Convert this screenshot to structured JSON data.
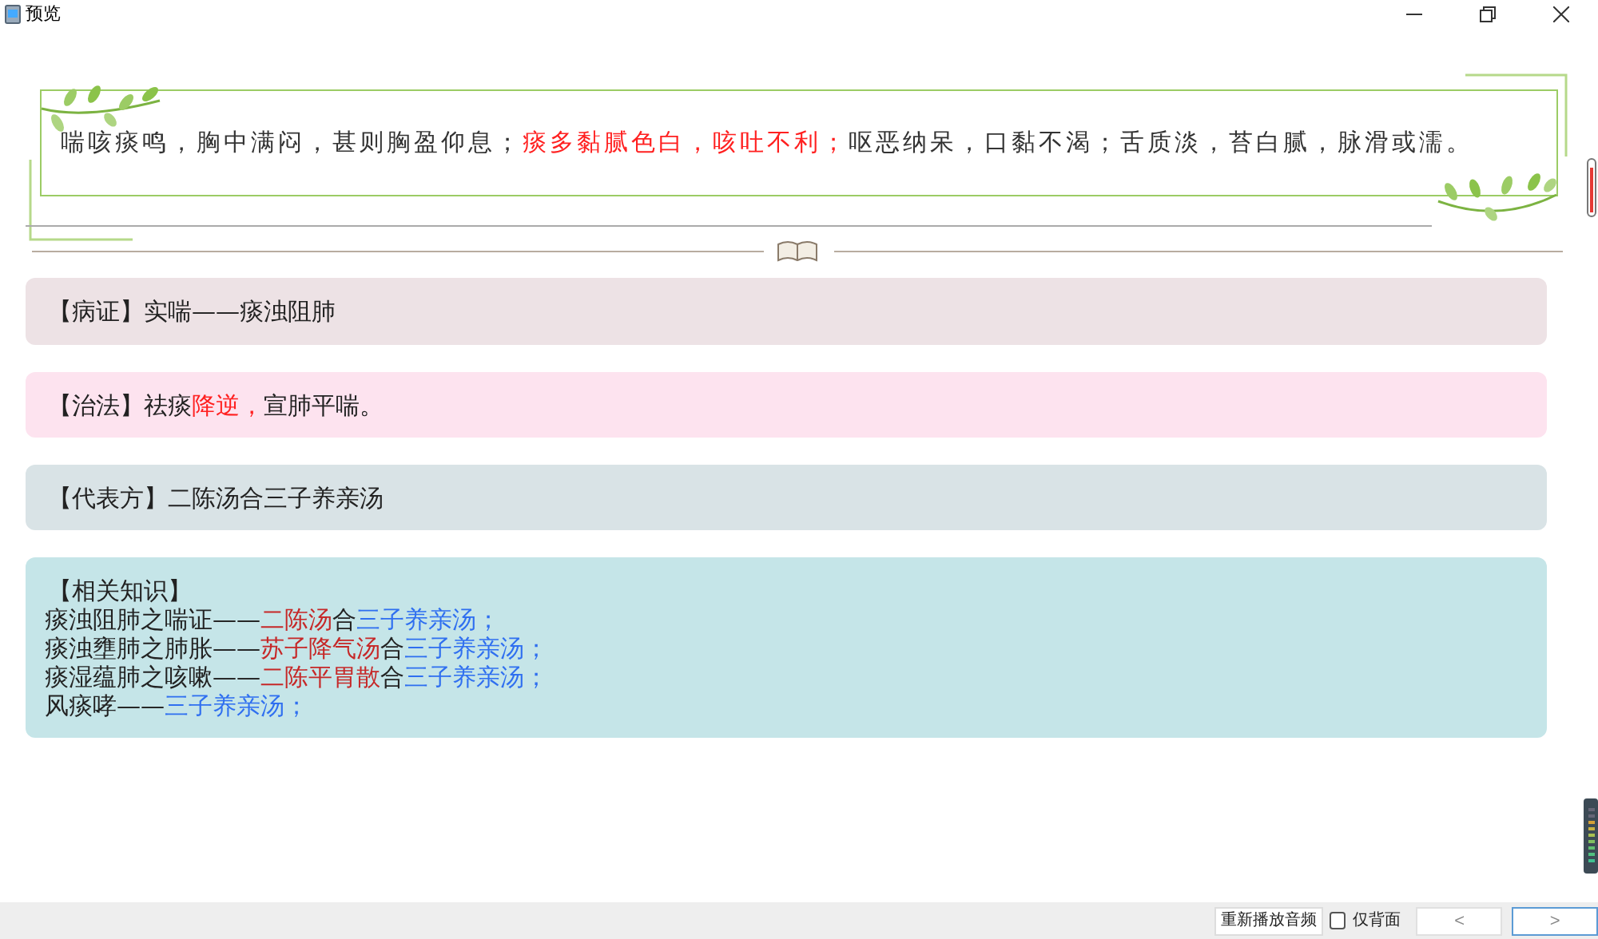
{
  "window": {
    "title": "预览"
  },
  "symptoms": [
    {
      "text": "喘咳痰鸣，胸中满闷，甚则胸盈仰息；",
      "kind": "normal"
    },
    {
      "text": "痰多黏腻色白，咳吐不利；",
      "kind": "key"
    },
    {
      "text": "呕恶纳呆，口黏不渴；舌质淡，苔白腻，脉滑或濡。",
      "kind": "normal"
    }
  ],
  "cards": [
    {
      "kind": "syndrome",
      "lines": [
        [
          {
            "text": "【病证】实喘——痰浊阻肺",
            "kind": "normal"
          }
        ]
      ]
    },
    {
      "kind": "method",
      "lines": [
        [
          {
            "text": "【治法】祛痰",
            "kind": "normal"
          },
          {
            "text": "降逆，",
            "kind": "key"
          },
          {
            "text": "宣肺平喘。",
            "kind": "normal"
          }
        ]
      ]
    },
    {
      "kind": "formula",
      "lines": [
        [
          {
            "text": "【代表方】二陈汤合三子养亲汤",
            "kind": "normal"
          }
        ]
      ]
    },
    {
      "kind": "knowledge",
      "lines": [
        [
          {
            "text": "【相关知识】",
            "kind": "normal"
          }
        ],
        [
          {
            "text": "痰浊阻肺之喘证——",
            "kind": "normal"
          },
          {
            "text": "二陈汤",
            "kind": "main"
          },
          {
            "text": "合",
            "kind": "normal"
          },
          {
            "text": "三子养亲汤；",
            "kind": "combo"
          }
        ],
        [
          {
            "text": "痰浊壅肺之肺胀——",
            "kind": "normal"
          },
          {
            "text": "苏子降气汤",
            "kind": "main"
          },
          {
            "text": "合",
            "kind": "normal"
          },
          {
            "text": "三子养亲汤；",
            "kind": "combo"
          }
        ],
        [
          {
            "text": "痰湿蕴肺之咳嗽——",
            "kind": "normal"
          },
          {
            "text": "二陈平胃散",
            "kind": "main"
          },
          {
            "text": "合",
            "kind": "normal"
          },
          {
            "text": "三子养亲汤；",
            "kind": "combo"
          }
        ],
        [
          {
            "text": "风痰哮——",
            "kind": "normal"
          },
          {
            "text": "三子养亲汤；",
            "kind": "combo"
          }
        ]
      ]
    }
  ],
  "bottom_bar": {
    "replay_button": "重新播放音频",
    "back_only": {
      "label": "仅背面",
      "checked": false
    },
    "prev_button": "<",
    "next_button": ">"
  }
}
